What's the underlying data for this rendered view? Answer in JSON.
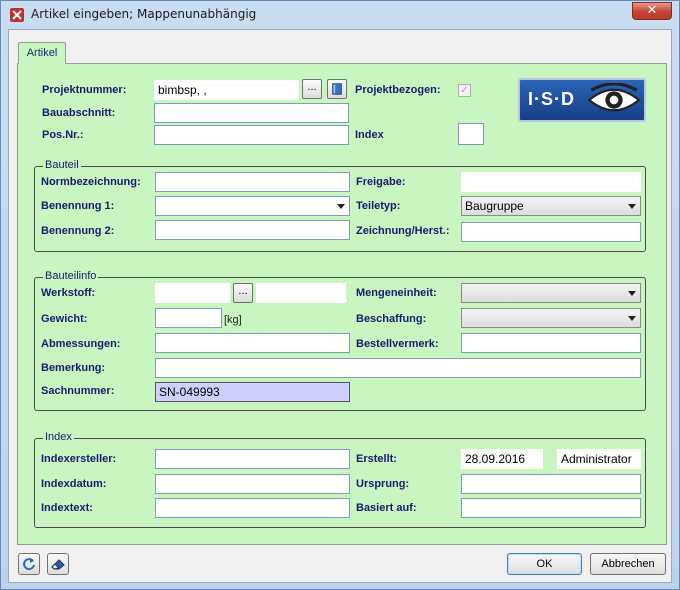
{
  "window": {
    "title": "Artikel eingeben; Mappenunabhängig",
    "close_label": "✕"
  },
  "tab": {
    "label": "Artikel"
  },
  "header": {
    "projektnummer_label": "Projektnummer:",
    "projektnummer_value": "bimbsp, ,",
    "browse_label": "...",
    "bauabschnitt_label": "Bauabschnitt:",
    "bauabschnitt_value": "",
    "posnr_label": "Pos.Nr.:",
    "posnr_value": "",
    "projektbezogen_label": "Projektbezogen:",
    "projektbezogen_checked": "✓",
    "index_label": "Index",
    "index_value": ""
  },
  "logo": {
    "text": "I·S·D"
  },
  "bauteil": {
    "title": "Bauteil",
    "normbezeichnung_label": "Normbezeichnung:",
    "normbezeichnung_value": "",
    "benennung1_label": "Benennung 1:",
    "benennung1_value": "",
    "benennung2_label": "Benennung 2:",
    "benennung2_value": "",
    "freigabe_label": "Freigabe:",
    "freigabe_value": "",
    "teiletyp_label": "Teiletyp:",
    "teiletyp_value": "Baugruppe",
    "zeichnung_label": "Zeichnung/Herst.:",
    "zeichnung_value": ""
  },
  "bauteilinfo": {
    "title": "Bauteilinfo",
    "werkstoff_label": "Werkstoff:",
    "werkstoff_value": "",
    "werkstoff_browse": "...",
    "werkstoff_extra": "",
    "gewicht_label": "Gewicht:",
    "gewicht_value": "",
    "gewicht_unit": "[kg]",
    "abmessungen_label": "Abmessungen:",
    "abmessungen_value": "",
    "bemerkung_label": "Bemerkung:",
    "bemerkung_value": "",
    "sachnummer_label": "Sachnummer:",
    "sachnummer_value": "SN-049993",
    "mengeneinheit_label": "Mengeneinheit:",
    "mengeneinheit_value": "",
    "beschaffung_label": "Beschaffung:",
    "beschaffung_value": "",
    "bestellvermerk_label": "Bestellvermerk:",
    "bestellvermerk_value": ""
  },
  "index": {
    "title": "Index",
    "indexersteller_label": "Indexersteller:",
    "indexersteller_value": "",
    "indexdatum_label": "Indexdatum:",
    "indexdatum_value": "",
    "indextext_label": "Indextext:",
    "indextext_value": "",
    "erstellt_label": "Erstellt:",
    "erstellt_date": "28.09.2016",
    "erstellt_user": "Administrator",
    "ursprung_label": "Ursprung:",
    "ursprung_value": "",
    "basiert_label": "Basiert auf:",
    "basiert_value": ""
  },
  "footer": {
    "ok_label": "OK",
    "cancel_label": "Abbrechen"
  },
  "colors": {
    "panel": "#c8f5c0",
    "label": "#1a1a6e",
    "sachnummer_bg": "#cfcfff",
    "logo_blue": "#1f4f9e"
  }
}
